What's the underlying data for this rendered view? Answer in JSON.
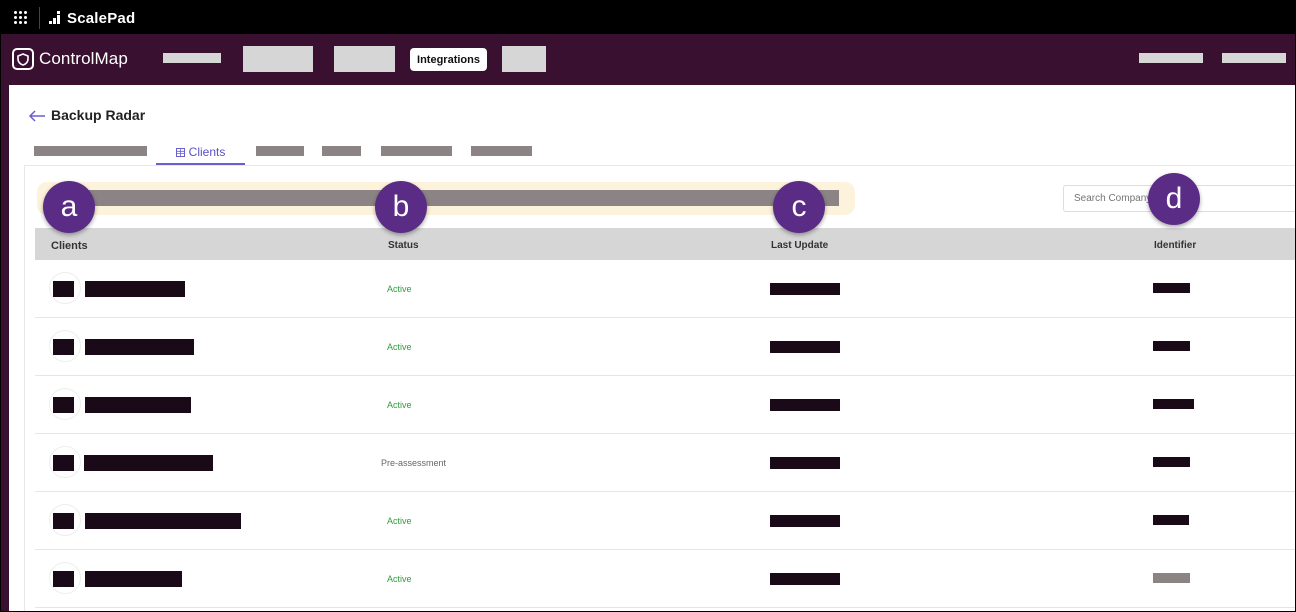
{
  "topbar": {
    "brand": "ScalePad"
  },
  "navbar": {
    "app_name": "ControlMap",
    "active_item": "Integrations"
  },
  "page": {
    "title": "Backup Radar",
    "active_tab": "Clients"
  },
  "search": {
    "placeholder": "Search Company"
  },
  "table": {
    "columns": [
      "Clients",
      "Status",
      "Last Update",
      "Identifier"
    ],
    "rows": [
      {
        "status": "Active",
        "status_color": "#2e9e3a"
      },
      {
        "status": "Active",
        "status_color": "#2e9e3a"
      },
      {
        "status": "Active",
        "status_color": "#2e9e3a"
      },
      {
        "status": "Pre-assessment",
        "status_color": "#666666"
      },
      {
        "status": "Active",
        "status_color": "#2e9e3a"
      },
      {
        "status": "Active",
        "status_color": "#2e9e3a"
      }
    ]
  },
  "callouts": [
    "a",
    "b",
    "c",
    "d"
  ],
  "colors": {
    "brand_purple": "#3a1030",
    "accent": "#5b50c8",
    "callout": "#5b2c86",
    "redaction": "#1a0a18"
  }
}
